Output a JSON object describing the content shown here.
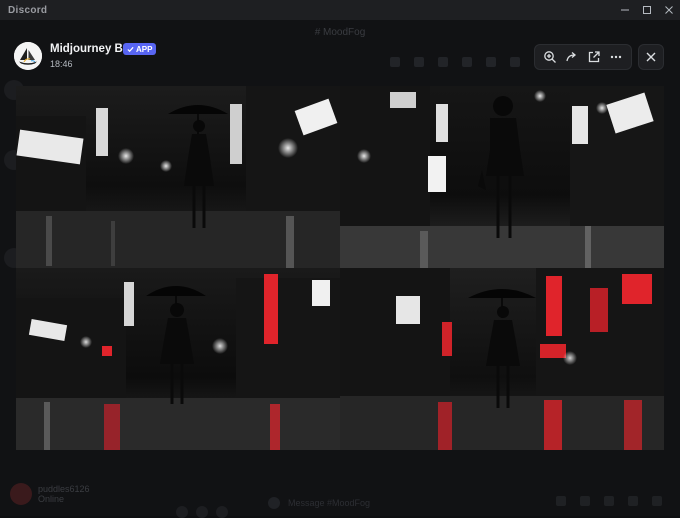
{
  "window": {
    "app_name": "Discord",
    "controls": [
      "minimize",
      "maximize",
      "close"
    ]
  },
  "background": {
    "channel_title": "# MoodFog",
    "user": {
      "name": "puddles6126",
      "status": "Online"
    },
    "input_placeholder": "Message #MoodFog"
  },
  "viewer": {
    "author": "Midjourney Bot",
    "badge": "APP",
    "timestamp": "18:46",
    "actions": [
      "zoom-in",
      "forward",
      "open-in-new",
      "more"
    ],
    "colors": {
      "badge": "#5865f2",
      "neon_red": "#e0242b"
    }
  },
  "images": [
    {
      "position": "top-left",
      "subject": "woman with umbrella, rainy neon street",
      "tint": "monochrome"
    },
    {
      "position": "top-right",
      "subject": "woman holding closed umbrella, rainy city",
      "tint": "monochrome"
    },
    {
      "position": "bottom-left",
      "subject": "woman with umbrella, red neon reflections",
      "tint": "red-accent"
    },
    {
      "position": "bottom-right",
      "subject": "woman with umbrella, red neon signs",
      "tint": "red-accent"
    }
  ]
}
